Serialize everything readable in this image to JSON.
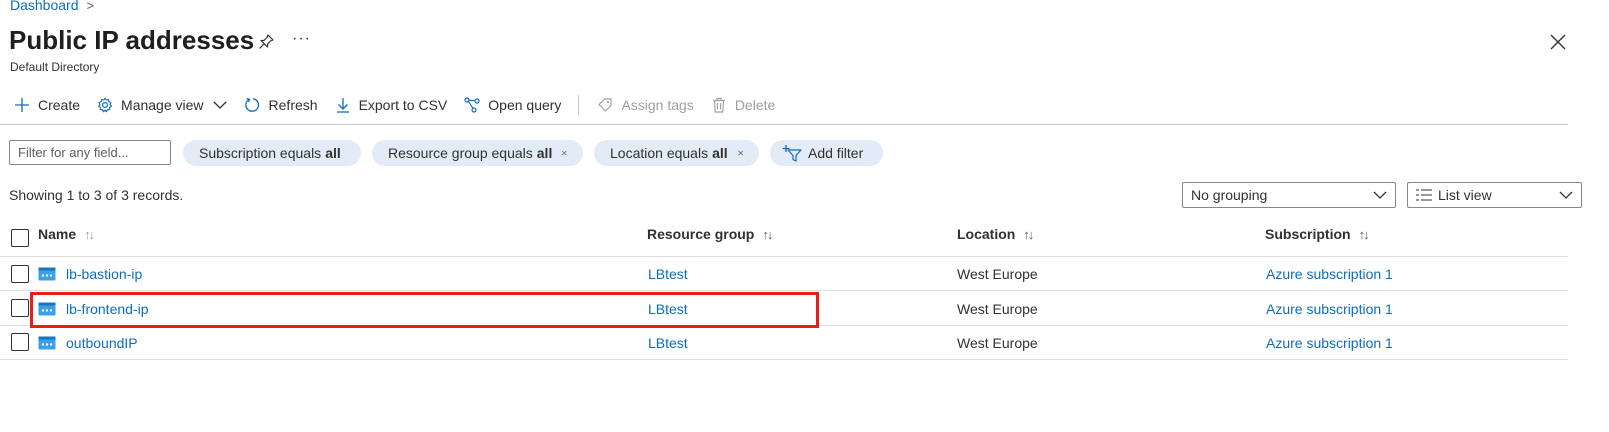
{
  "breadcrumb": {
    "root": "Dashboard",
    "separator": ">"
  },
  "header": {
    "title": "Public IP addresses",
    "subtitle": "Default Directory",
    "more": "···"
  },
  "toolbar": {
    "create": "Create",
    "manage_view": "Manage view",
    "refresh": "Refresh",
    "export_csv": "Export to CSV",
    "open_query": "Open query",
    "assign_tags": "Assign tags",
    "delete": "Delete"
  },
  "filters": {
    "placeholder": "Filter for any field...",
    "subscription_label": "Subscription equals",
    "subscription_value": "all",
    "resource_group_label": "Resource group equals",
    "resource_group_value": "all",
    "location_label": "Location equals",
    "location_value": "all",
    "add_filter": "Add filter"
  },
  "records_text": "Showing 1 to 3 of 3 records.",
  "grouping": {
    "selected": "No grouping"
  },
  "view": {
    "selected": "List view"
  },
  "table": {
    "columns": [
      "Name",
      "Resource group",
      "Location",
      "Subscription"
    ],
    "rows": [
      {
        "name": "lb-bastion-ip",
        "resource_group": "LBtest",
        "location": "West Europe",
        "subscription": "Azure subscription 1"
      },
      {
        "name": "lb-frontend-ip",
        "resource_group": "LBtest",
        "location": "West Europe",
        "subscription": "Azure subscription 1"
      },
      {
        "name": "outboundIP",
        "resource_group": "LBtest",
        "location": "West Europe",
        "subscription": "Azure subscription 1"
      }
    ]
  },
  "colors": {
    "link": "#0f6cbd",
    "pill": "#e3ebf6",
    "highlight": "#e02020",
    "ip_icon": "#3aa0e8"
  }
}
